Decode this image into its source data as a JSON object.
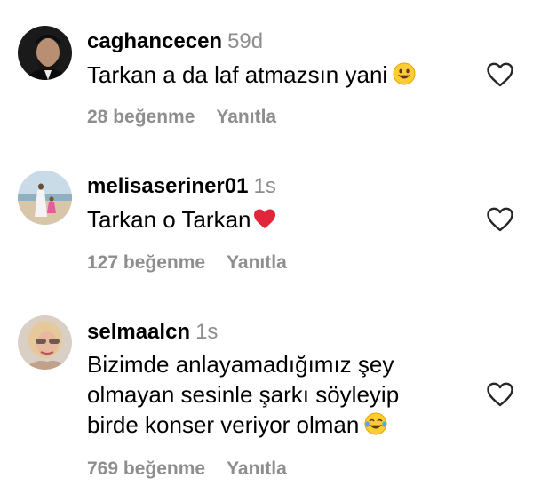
{
  "comments": [
    {
      "username": "caghancecen",
      "time": "59d",
      "text": "Tarkan a da laf atmazsın yani",
      "emoji": "grinning-face",
      "likes_label": "28 beğenme",
      "reply_label": "Yanıtla"
    },
    {
      "username": "melisaseriner01",
      "time": "1s",
      "text": "Tarkan o Tarkan",
      "emoji": "red-heart",
      "likes_label": "127 beğenme",
      "reply_label": "Yanıtla"
    },
    {
      "username": "selmaalcn",
      "time": "1s",
      "text_lines": [
        "Bizimde anlayamadığımız şey",
        "olmayan sesinle şarkı söyleyip",
        "birde konser veriyor olman"
      ],
      "emoji": "face-with-tears-of-joy",
      "likes_label": "769 beğenme",
      "reply_label": "Yanıtla"
    }
  ],
  "colors": {
    "text": "#000000",
    "muted": "#8e8e8e",
    "heart_outline": "#262626"
  },
  "icons": {
    "like": "heart-outline-icon"
  }
}
